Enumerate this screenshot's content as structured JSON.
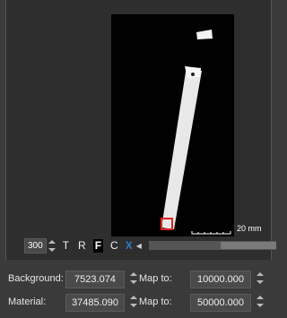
{
  "toolbar": {
    "zoom_value": "300",
    "btn_t": "T",
    "btn_r": "R",
    "btn_f": "F",
    "btn_c": "C",
    "btn_x": "X"
  },
  "viewport": {
    "scale_label": "20 mm"
  },
  "background_row": {
    "label": "Background:",
    "value": "7523.074",
    "map_label": "Map to:",
    "map_value": "10000.000"
  },
  "material_row": {
    "label": "Material:",
    "value": "37485.090",
    "map_label": "Map to:",
    "map_value": "50000.000"
  }
}
